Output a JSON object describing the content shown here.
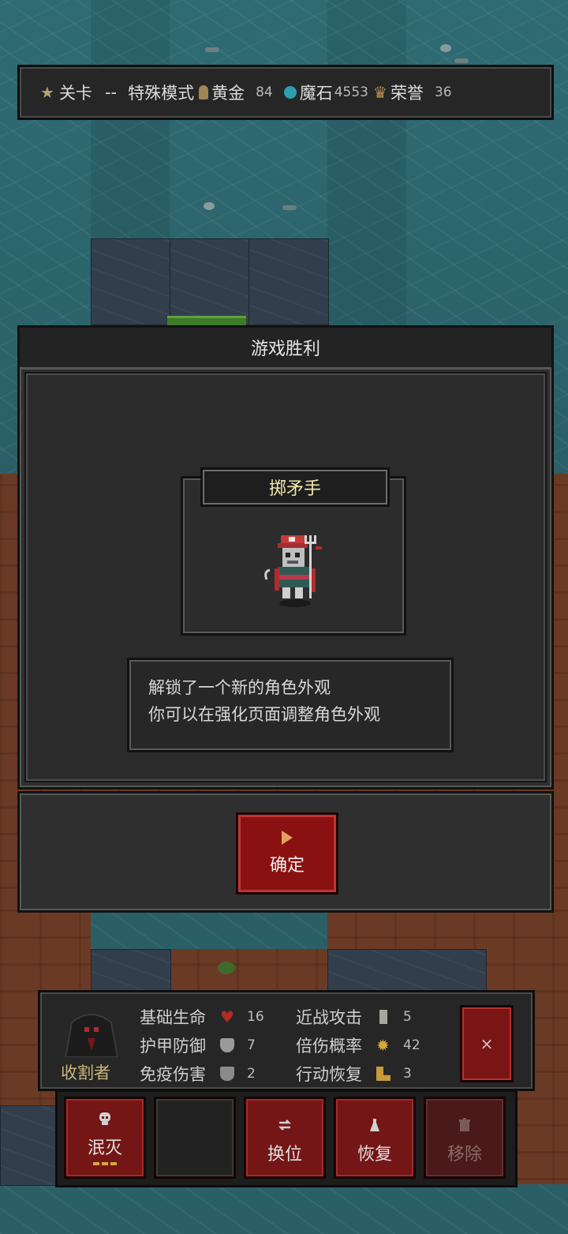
{
  "hud": {
    "level_label": "关卡",
    "level_value": "--",
    "mode": "特殊模式",
    "gold_label": "黄金",
    "gold_value": "84",
    "magic_label": "魔石",
    "magic_value": "4553",
    "honor_label": "荣誉",
    "honor_value": "36"
  },
  "dialog": {
    "title": "游戏胜利",
    "card_title": "掷矛手",
    "message_line1": "解锁了一个新的角色外观",
    "message_line2": "你可以在强化页面调整角色外观",
    "confirm_label": "确定"
  },
  "character": {
    "name": "收割者",
    "stats": [
      {
        "label": "基础生命",
        "value": "16",
        "icon": "heart-icon",
        "color": "#b02a2a"
      },
      {
        "label": "护甲防御",
        "value": "7",
        "icon": "shield-icon",
        "color": "#9a9a9a"
      },
      {
        "label": "免疫伤害",
        "value": "2",
        "icon": "guard-icon",
        "color": "#8a8a8a"
      },
      {
        "label": "近战攻击",
        "value": "5",
        "icon": "sword-icon",
        "color": "#b0b0a0"
      },
      {
        "label": "倍伤概率",
        "value": "42",
        "icon": "burst-icon",
        "color": "#d6a93a"
      },
      {
        "label": "行动恢复",
        "value": "3",
        "icon": "boot-icon",
        "color": "#c99a3a"
      }
    ],
    "close_label": "×"
  },
  "actions": {
    "destroy": "泯灭",
    "swap": "换位",
    "restore": "恢复",
    "remove": "移除"
  }
}
